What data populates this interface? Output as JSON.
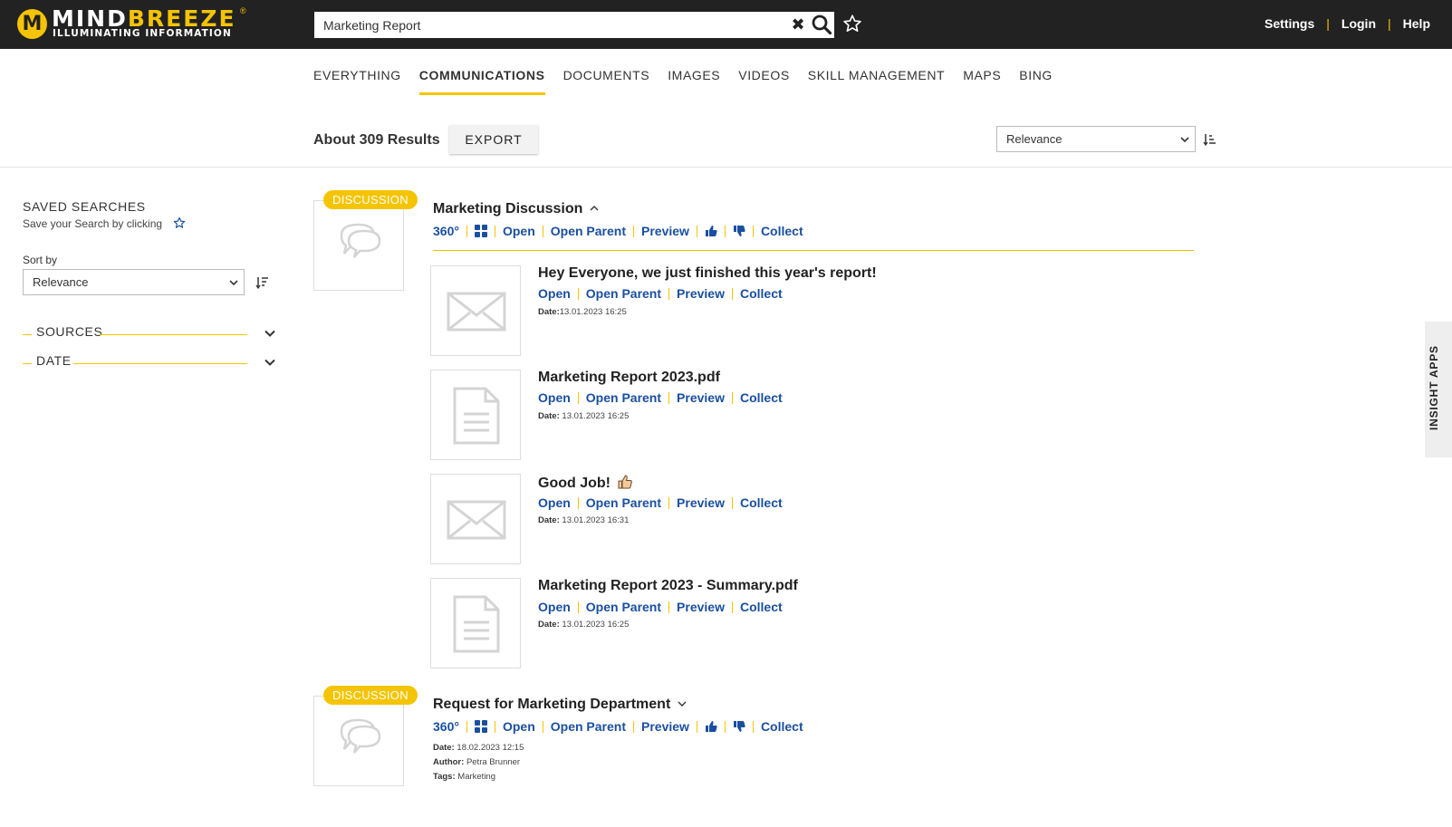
{
  "header": {
    "logo_word_a": "MIND",
    "logo_word_b": "BREEZE",
    "logo_tagline": "ILLUMINATING INFORMATION",
    "search_value": "Marketing Report",
    "links": [
      "Settings",
      "Login",
      "Help"
    ]
  },
  "tabs": [
    "EVERYTHING",
    "COMMUNICATIONS",
    "DOCUMENTS",
    "IMAGES",
    "VIDEOS",
    "SKILL MANAGEMENT",
    "MAPS",
    "BING"
  ],
  "active_tab": "COMMUNICATIONS",
  "results_bar": {
    "count_label": "About 309 Results",
    "export_label": "EXPORT",
    "sort_value": "Relevance"
  },
  "sidebar": {
    "saved_title": "SAVED SEARCHES",
    "saved_sub": "Save your Search by clicking",
    "sortby_label": "Sort by",
    "sort_value": "Relevance",
    "facets": [
      "SOURCES",
      "DATE"
    ]
  },
  "results": [
    {
      "badge": "DISCUSSION",
      "title": "Marketing Discussion",
      "actions": [
        "360°",
        "Open",
        "Open Parent",
        "Preview",
        "Collect"
      ],
      "children": [
        {
          "title": "Hey Everyone, we just finished this year's report!",
          "actions": [
            "Open",
            "Open Parent",
            "Preview",
            "Collect"
          ],
          "date_label": "Date:",
          "date": "13.01.2023 16:25",
          "icon": "mail"
        },
        {
          "title": "Marketing Report 2023.pdf",
          "actions": [
            "Open",
            "Open Parent",
            "Preview",
            "Collect"
          ],
          "date_label": "Date:",
          "date": "13.01.2023 16:25",
          "icon": "document"
        },
        {
          "title": "Good Job!",
          "actions": [
            "Open",
            "Open Parent",
            "Preview",
            "Collect"
          ],
          "date_label": "Date:",
          "date": "13.01.2023 16:31",
          "icon": "mail"
        },
        {
          "title": "Marketing Report 2023 - Summary.pdf",
          "actions": [
            "Open",
            "Open Parent",
            "Preview",
            "Collect"
          ],
          "date_label": "Date:",
          "date": "13.01.2023 16:25",
          "icon": "document"
        }
      ]
    },
    {
      "badge": "DISCUSSION",
      "title": "Request for Marketing Department",
      "actions": [
        "360°",
        "Open",
        "Open Parent",
        "Preview",
        "Collect"
      ],
      "date_label": "Date:",
      "date": "18.02.2023 12:15",
      "author_label": "Author:",
      "author": "Petra Brunner",
      "tags_label": "Tags:",
      "tags": "Marketing"
    }
  ],
  "side_tab": "INSIGHT APPS",
  "colors": {
    "accent": "#f5c400",
    "link": "#1a4fa0",
    "header_bg": "#222222"
  }
}
